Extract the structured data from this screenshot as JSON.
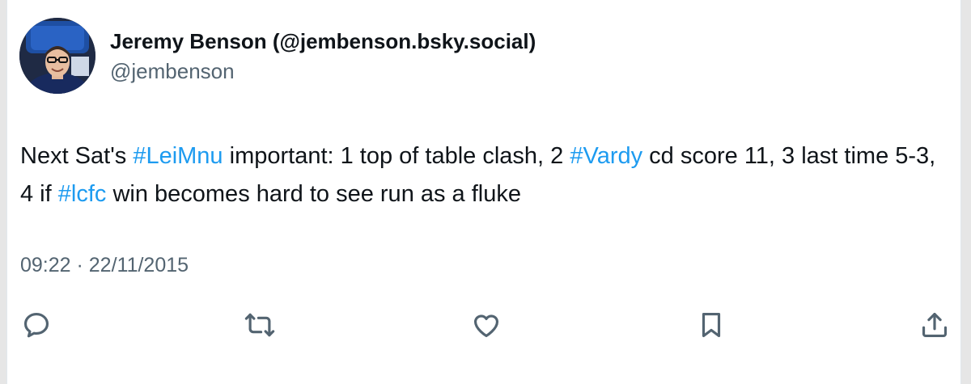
{
  "author": {
    "display_name": "Jeremy Benson (@jembenson.bsky.social)",
    "handle": "@jembenson"
  },
  "tweet": {
    "segments": [
      {
        "text": "Next Sat's ",
        "type": "text"
      },
      {
        "text": "#LeiMnu",
        "type": "hashtag"
      },
      {
        "text": " important: 1 top of table clash, 2 ",
        "type": "text"
      },
      {
        "text": "#Vardy",
        "type": "hashtag"
      },
      {
        "text": " cd score 11, 3 last time 5-3, 4 if ",
        "type": "text"
      },
      {
        "text": "#lcfc",
        "type": "hashtag"
      },
      {
        "text": " win becomes hard to see run as a fluke",
        "type": "text"
      }
    ],
    "timestamp": "09:22 · 22/11/2015"
  },
  "actions": [
    {
      "icon": "reply-icon"
    },
    {
      "icon": "retweet-icon"
    },
    {
      "icon": "like-icon"
    },
    {
      "icon": "bookmark-icon"
    },
    {
      "icon": "share-icon"
    }
  ],
  "colors": {
    "hashtag": "#1d9bf0",
    "text": "#0f1419",
    "muted": "#536471",
    "icon": "#536471"
  }
}
